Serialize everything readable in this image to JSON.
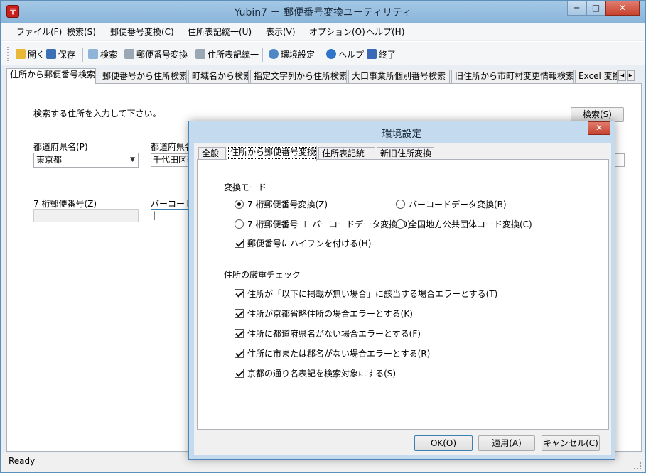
{
  "window": {
    "title": "Yubin7 － 郵便番号変換ユーティリティ",
    "app_icon": "〒"
  },
  "menu": [
    "ファイル(F)",
    "検索(S)",
    "郵便番号変換(C)",
    "住所表記統一(U)",
    "表示(V)",
    "オプション(O)",
    "ヘルプ(H)"
  ],
  "toolbar": {
    "open": "開く",
    "save": "保存",
    "search": "検索",
    "zip_convert": "郵便番号変換",
    "addr_unify": "住所表記統一",
    "settings": "環境設定",
    "help": "ヘルプ",
    "exit": "終了"
  },
  "tabs": [
    "住所から郵便番号検索",
    "郵便番号から住所検索",
    "町域名から検索",
    "指定文字列から住所検索",
    "大口事業所個別番号検索",
    "旧住所から市町村変更情報検索",
    "Excel 変換"
  ],
  "main": {
    "instruction": "検索する住所を入力して下さい。",
    "search_button": "検索(S)",
    "pref_label": "都道府県名(P)",
    "pref_value": "東京都",
    "city_label": "都道府県名",
    "city_value": "千代田区麴",
    "zip_label": "7 桁郵便番号(Z)",
    "zip_value": "",
    "barcode_label": "バーコードデ",
    "barcode_value": "|"
  },
  "status": {
    "text": "Ready"
  },
  "dialog": {
    "title": "環境設定",
    "close": "✕",
    "tabs": [
      "全般",
      "住所から郵便番号変換",
      "住所表記統一",
      "新旧住所変換"
    ],
    "mode_group": "変換モード",
    "modes": [
      {
        "label": "7 桁郵便番号変換(Z)",
        "selected": true
      },
      {
        "label": "バーコードデータ変換(B)",
        "selected": false
      },
      {
        "label": "7 桁郵便番号 ＋ バーコードデータ変換(D)",
        "selected": false
      },
      {
        "label": "全国地方公共団体コード変換(C)",
        "selected": false
      }
    ],
    "hyphen": {
      "label": "郵便番号にハイフンを付ける(H)",
      "checked": true
    },
    "strict_group": "住所の厳重チェック",
    "checks": [
      {
        "label": "住所が「以下に掲載が無い場合」に該当する場合エラーとする(T)",
        "checked": true
      },
      {
        "label": "住所が京都省略住所の場合エラーとする(K)",
        "checked": true
      },
      {
        "label": "住所に都道府県名がない場合エラーとする(F)",
        "checked": true
      },
      {
        "label": "住所に市または郡名がない場合エラーとする(R)",
        "checked": true
      },
      {
        "label": "京都の通り名表記を検索対象にする(S)",
        "checked": true
      }
    ],
    "ok": "OK(O)",
    "apply": "適用(A)",
    "cancel": "キャンセル(C)"
  }
}
